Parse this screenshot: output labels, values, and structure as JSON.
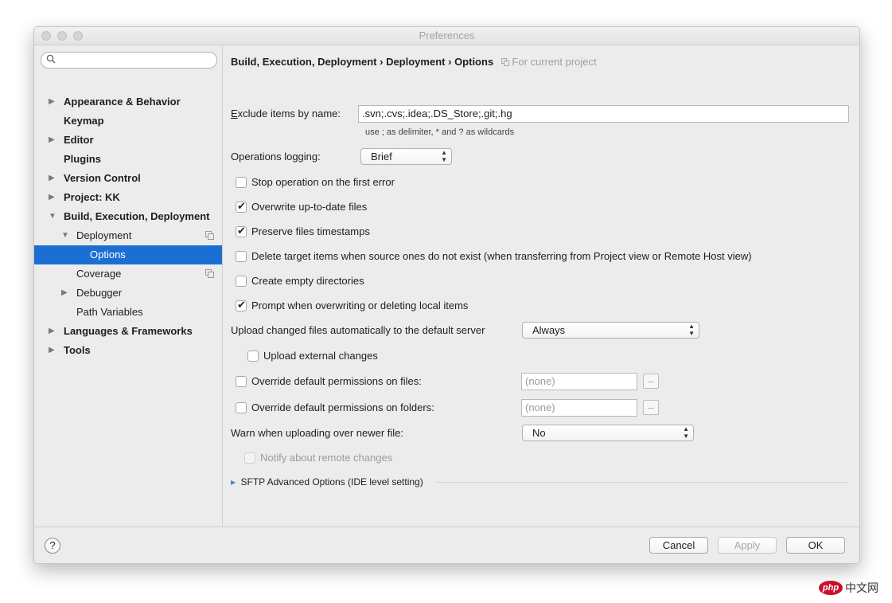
{
  "window": {
    "title": "Preferences"
  },
  "sidebar": {
    "search_placeholder": "",
    "items": [
      {
        "label": "Appearance & Behavior",
        "expand": "▶"
      },
      {
        "label": "Keymap"
      },
      {
        "label": "Editor",
        "expand": "▶"
      },
      {
        "label": "Plugins"
      },
      {
        "label": "Version Control",
        "expand": "▶"
      },
      {
        "label": "Project: KK",
        "expand": "▶"
      },
      {
        "label": "Build, Execution, Deployment",
        "expand": "▼"
      },
      {
        "label": "Deployment",
        "expand": "▼"
      },
      {
        "label": "Options"
      },
      {
        "label": "Coverage"
      },
      {
        "label": "Debugger",
        "expand": "▶"
      },
      {
        "label": "Path Variables"
      },
      {
        "label": "Languages & Frameworks",
        "expand": "▶"
      },
      {
        "label": "Tools",
        "expand": "▶"
      }
    ]
  },
  "header": {
    "crumb1": "Build, Execution, Deployment",
    "crumb2": "Deployment",
    "crumb3": "Options",
    "separator": "›",
    "scope": "For current project"
  },
  "form": {
    "exclude_label_first": "E",
    "exclude_label_rest": "xclude items by name:",
    "exclude_value": ".svn;.cvs;.idea;.DS_Store;.git;.hg",
    "exclude_hint": "use ; as delimiter, * and ? as wildcards",
    "ops_logging_label": "Operations logging:",
    "ops_logging_value": "Brief",
    "checkboxes": [
      {
        "label": "Stop operation on the first error",
        "checked": false
      },
      {
        "label": "Overwrite up-to-date files",
        "checked": true
      },
      {
        "label": "Preserve files timestamps",
        "checked": true
      },
      {
        "label": "Delete target items when source ones do not exist (when transferring from Project view or Remote Host view)",
        "checked": false
      },
      {
        "label": "Create empty directories",
        "checked": false
      },
      {
        "label": "Prompt when overwriting or deleting local items",
        "checked": true
      }
    ],
    "upload_auto_label": "Upload changed files automatically to the default server",
    "upload_auto_value": "Always",
    "upload_external_label": "Upload external changes",
    "override_files_label": "Override default permissions on files:",
    "override_files_value": "(none)",
    "override_folders_label": "Override default permissions on folders:",
    "override_folders_value": "(none)",
    "browse_label": "...",
    "warn_label": "Warn when uploading over newer file:",
    "warn_value": "No",
    "notify_label": "Notify about remote changes",
    "sftp_label": "SFTP Advanced Options (IDE level setting)"
  },
  "footer": {
    "help_label": "?",
    "cancel_label": "Cancel",
    "apply_label": "Apply",
    "ok_label": "OK"
  },
  "watermark": {
    "logo_text": "php",
    "site_text": "中文网"
  }
}
